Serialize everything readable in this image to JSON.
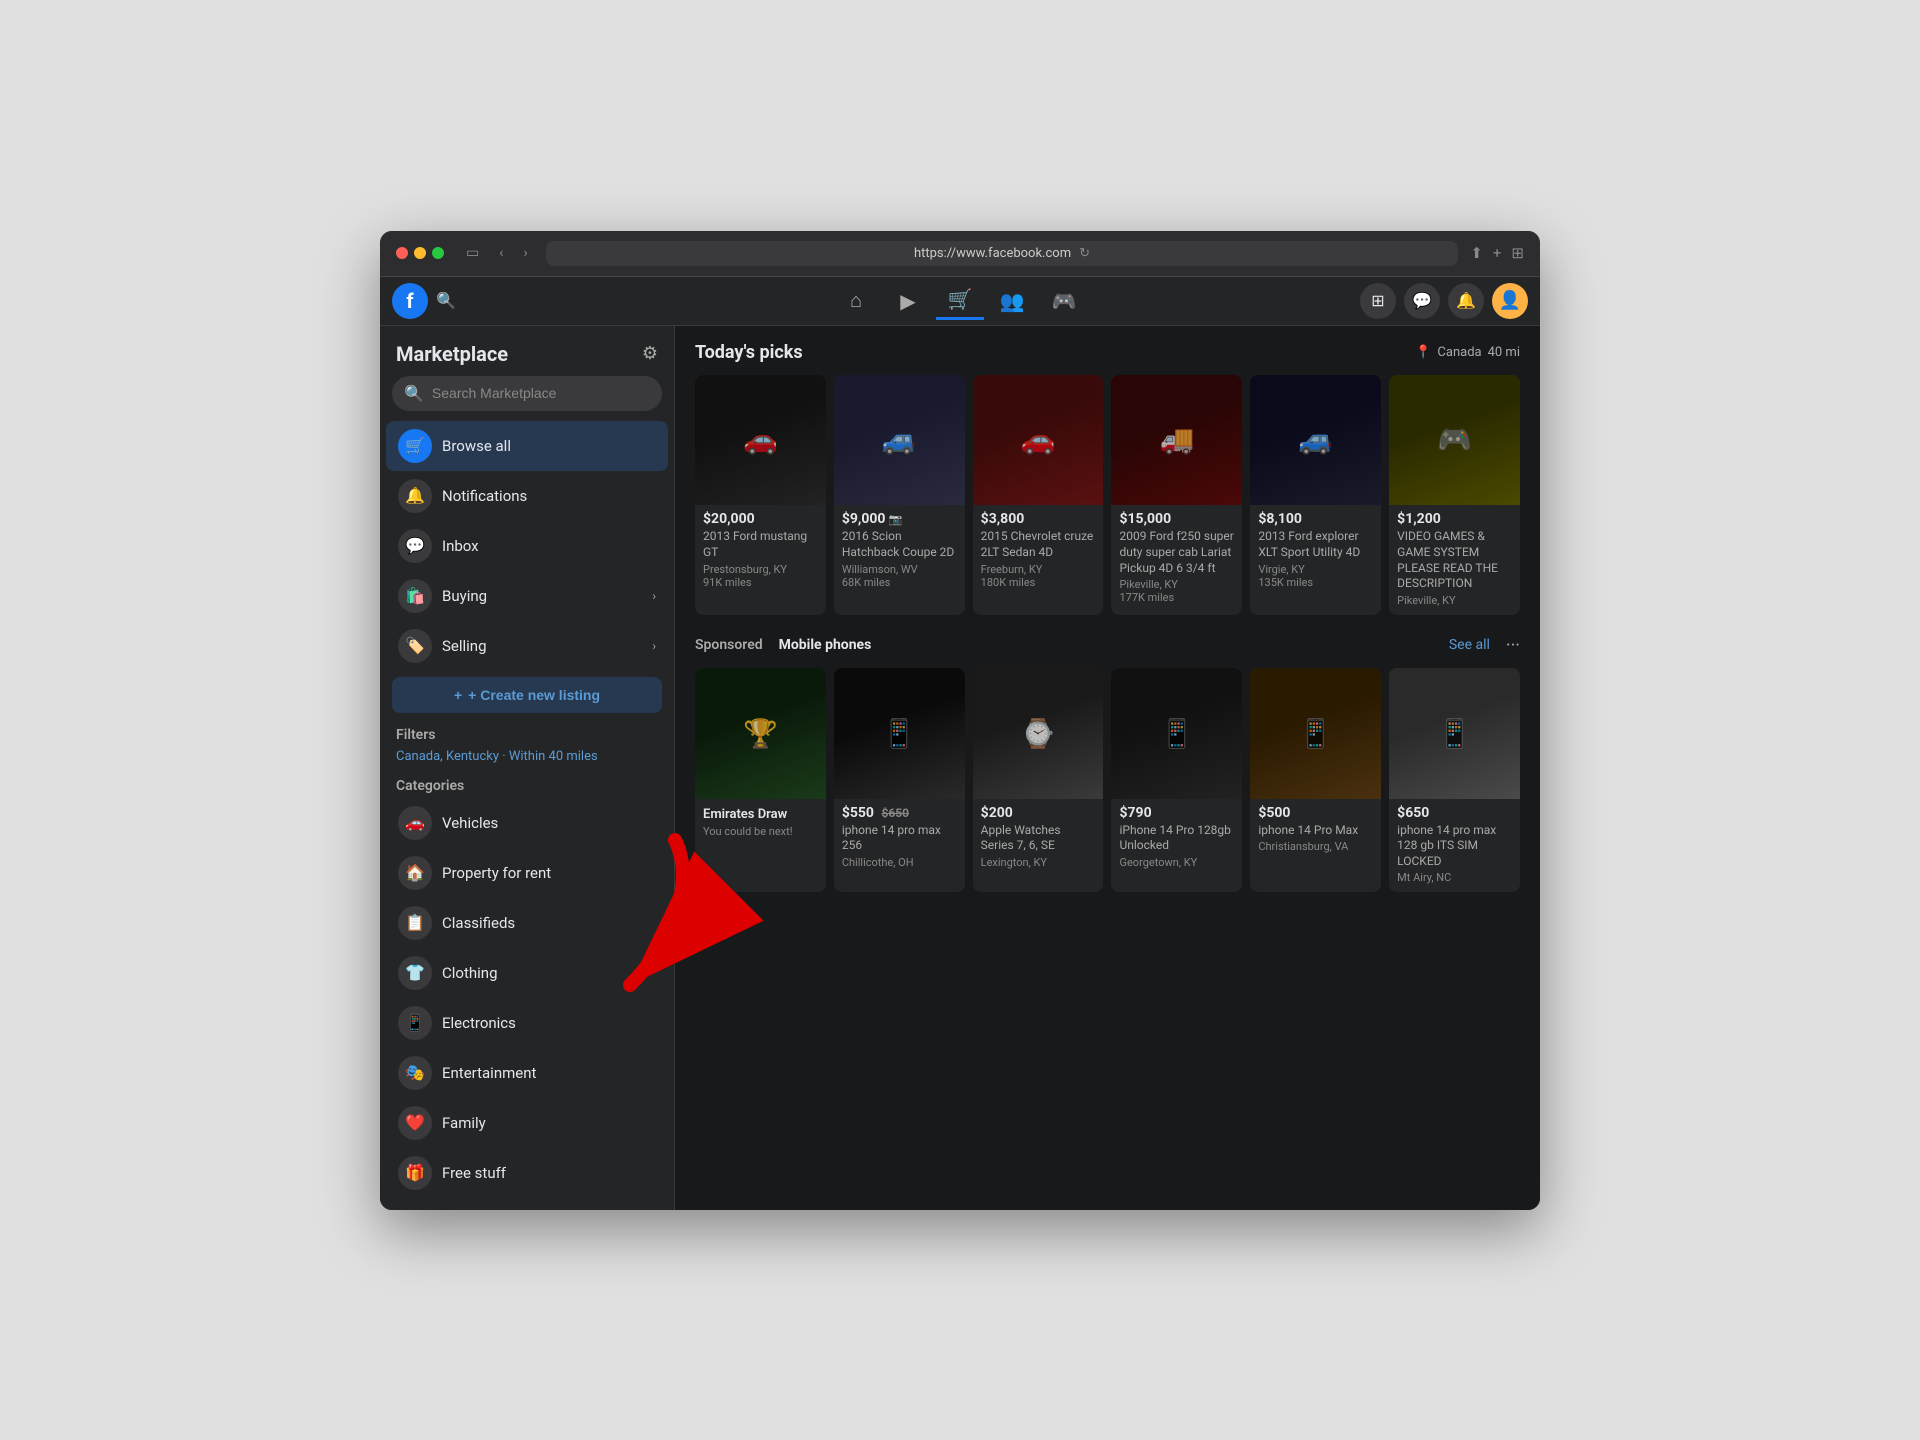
{
  "browser": {
    "url": "https://www.facebook.com",
    "refresh_icon": "↻"
  },
  "fb_nav": {
    "logo": "f",
    "nav_items": [
      {
        "id": "home",
        "icon": "⌂",
        "label": "Home",
        "active": false
      },
      {
        "id": "video",
        "icon": "▶",
        "label": "Watch",
        "active": false
      },
      {
        "id": "marketplace",
        "icon": "🛒",
        "label": "Marketplace",
        "active": true
      },
      {
        "id": "groups",
        "icon": "👥",
        "label": "Groups",
        "active": false
      },
      {
        "id": "gaming",
        "icon": "🎮",
        "label": "Gaming",
        "active": false
      }
    ]
  },
  "sidebar": {
    "title": "Marketplace",
    "search_placeholder": "Search Marketplace",
    "items": [
      {
        "id": "browse-all",
        "label": "Browse all",
        "icon": "🛒",
        "active": true
      },
      {
        "id": "notifications",
        "label": "Notifications",
        "icon": "🔔",
        "active": false
      },
      {
        "id": "inbox",
        "label": "Inbox",
        "icon": "💬",
        "active": false
      },
      {
        "id": "buying",
        "label": "Buying",
        "icon": "🛍️",
        "has_arrow": true,
        "active": false
      },
      {
        "id": "selling",
        "label": "Selling",
        "icon": "🏷️",
        "has_arrow": true,
        "active": false
      }
    ],
    "create_listing_label": "+ Create new listing",
    "filters_label": "Filters",
    "filter_value": "Canada, Kentucky · Within 40 miles",
    "categories_label": "Categories",
    "categories": [
      {
        "id": "vehicles",
        "label": "Vehicles",
        "icon": "🚗"
      },
      {
        "id": "property-rent",
        "label": "Property for rent",
        "icon": "🏠"
      },
      {
        "id": "classifieds",
        "label": "Classifieds",
        "icon": "📋"
      },
      {
        "id": "clothing",
        "label": "Clothing",
        "icon": "👕"
      },
      {
        "id": "electronics",
        "label": "Electronics",
        "icon": "📱"
      },
      {
        "id": "entertainment",
        "label": "Entertainment",
        "icon": "🎭"
      },
      {
        "id": "family",
        "label": "Family",
        "icon": "❤️"
      },
      {
        "id": "free-stuff",
        "label": "Free stuff",
        "icon": "🎁"
      }
    ]
  },
  "content": {
    "todays_picks": {
      "title": "Today's picks",
      "location": "Canada",
      "distance": "40 mi",
      "items": [
        {
          "price": "$20,000",
          "name": "2013 Ford mustang GT",
          "location": "Prestonsburg, KY",
          "miles": "91K miles",
          "img_class": "img-mustang"
        },
        {
          "price": "$9,000",
          "name": "2016 Scion Hatchback Coupe 2D",
          "location": "Williamson, WV",
          "miles": "68K miles",
          "img_class": "img-scion"
        },
        {
          "price": "$3,800",
          "name": "2015 Chevrolet cruze 2LT Sedan 4D",
          "location": "Freeburn, KY",
          "miles": "180K miles",
          "img_class": "img-cruze"
        },
        {
          "price": "$15,000",
          "name": "2009 Ford f250 super duty super cab Lariat Pickup 4D 6 3/4 ft",
          "location": "Pikeville, KY",
          "miles": "177K miles",
          "img_class": "img-f250"
        },
        {
          "price": "$8,100",
          "name": "2013 Ford explorer XLT Sport Utility 4D",
          "location": "Virgie, KY",
          "miles": "135K miles",
          "img_class": "img-explorer"
        },
        {
          "price": "$1,200",
          "name": "VIDEO GAMES & GAME SYSTEM PLEASE READ THE DESCRIPTION",
          "location": "Pikeville, KY",
          "miles": "",
          "img_class": "img-pikachu"
        }
      ]
    },
    "sponsored": {
      "sponsored_label": "Sponsored",
      "section_label": "Mobile phones",
      "see_all": "See all",
      "items": [
        {
          "price": "",
          "old_price": "",
          "name": "Emirates Draw",
          "sub": "You could be next!",
          "location": "",
          "img_class": "img-draw",
          "is_ad": true
        },
        {
          "price": "$550",
          "old_price": "$650",
          "name": "iphone 14 pro max 256",
          "sub": "",
          "location": "Chillicothe, OH",
          "img_class": "img-phone1",
          "is_ad": false
        },
        {
          "price": "$200",
          "old_price": "",
          "name": "Apple Watches Series 7, 6, SE",
          "sub": "",
          "location": "Lexington, KY",
          "img_class": "img-watch",
          "is_ad": false
        },
        {
          "price": "$790",
          "old_price": "",
          "name": "iPhone 14 Pro 128gb Unlocked",
          "sub": "",
          "location": "Georgetown, KY",
          "img_class": "img-iphone-black",
          "is_ad": false
        },
        {
          "price": "$500",
          "old_price": "",
          "name": "iphone 14 Pro Max",
          "sub": "",
          "location": "Christiansburg, VA",
          "img_class": "img-iphone-gold",
          "is_ad": false
        },
        {
          "price": "$650",
          "old_price": "",
          "name": "iphone 14 pro max 128 gb ITS SIM LOCKED",
          "sub": "",
          "location": "Mt Airy, NC",
          "img_class": "img-iphone-white",
          "is_ad": false
        }
      ]
    }
  }
}
